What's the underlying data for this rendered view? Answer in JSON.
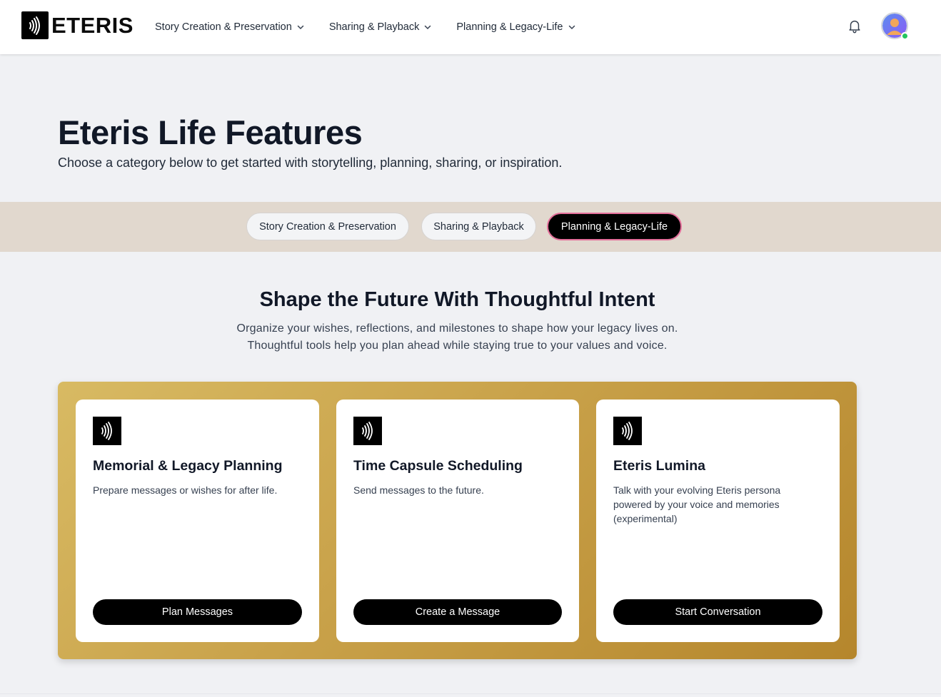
{
  "brand": {
    "name": "ETERIS"
  },
  "nav": {
    "items": [
      {
        "label": "Story Creation & Preservation"
      },
      {
        "label": "Sharing & Playback"
      },
      {
        "label": "Planning & Legacy-Life"
      }
    ]
  },
  "hero": {
    "title": "Eteris Life Features",
    "subtitle": "Choose a category below to get started with storytelling, planning, sharing, or inspiration."
  },
  "tabs": [
    {
      "label": "Story Creation & Preservation",
      "active": false
    },
    {
      "label": "Sharing & Playback",
      "active": false
    },
    {
      "label": "Planning & Legacy-Life",
      "active": true
    }
  ],
  "section": {
    "title": "Shape the Future With Thoughtful Intent",
    "desc_line1": "Organize your wishes, reflections, and milestones to shape how your legacy lives on.",
    "desc_line2": "Thoughtful tools help you plan ahead while staying true to your values and voice."
  },
  "cards": [
    {
      "title": "Memorial & Legacy Planning",
      "desc": "Prepare messages or wishes for after life.",
      "button": "Plan Messages"
    },
    {
      "title": "Time Capsule Scheduling",
      "desc": "Send messages to the future.",
      "button": "Create a Message"
    },
    {
      "title": "Eteris Lumina",
      "desc": "Talk with your evolving Eteris persona powered by your voice and memories (experimental)",
      "button": "Start Conversation"
    }
  ],
  "colors": {
    "accent_border": "#e46e9a",
    "tab_band": "#e1d8ce",
    "panel_gold": "#c9a24a",
    "status_online": "#22c55e"
  },
  "icons": {
    "logo": "sound-waves-logo-icon",
    "notifications": "bell-icon",
    "nav_dropdown": "chevron-down-icon",
    "card": "sound-waves-icon"
  }
}
